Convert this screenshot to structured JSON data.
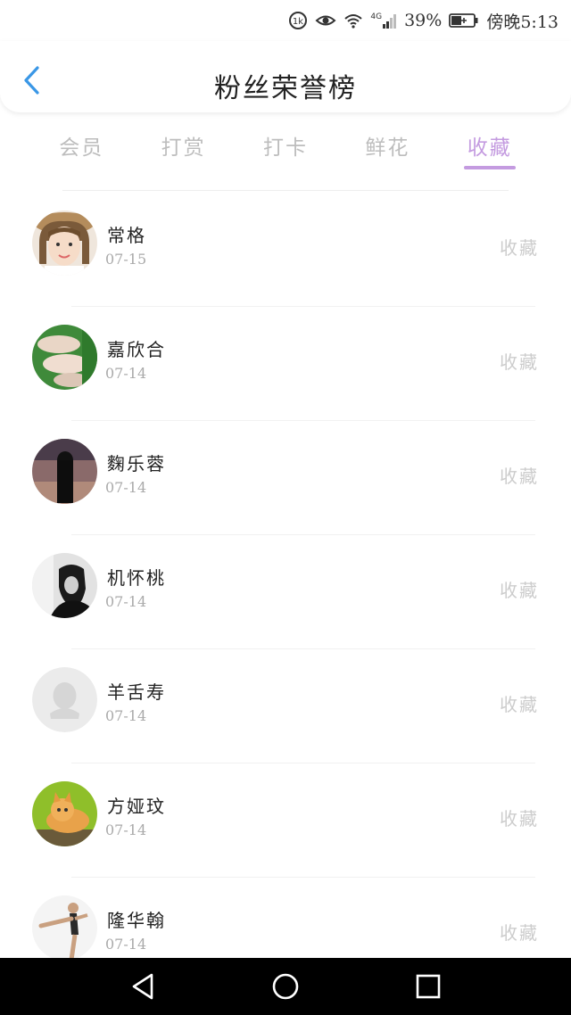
{
  "status_bar": {
    "badge_text": "1k",
    "network": "4G",
    "battery": "39%",
    "time": "傍晚5:13"
  },
  "header": {
    "title": "粉丝荣誉榜"
  },
  "tabs": [
    {
      "label": "会员"
    },
    {
      "label": "打赏"
    },
    {
      "label": "打卡"
    },
    {
      "label": "鲜花"
    },
    {
      "label": "收藏",
      "active": true
    }
  ],
  "list": [
    {
      "name": "常格",
      "date": "07-15",
      "action": "收藏",
      "avatar": "girl-photo"
    },
    {
      "name": "嘉欣合",
      "date": "07-14",
      "action": "收藏",
      "avatar": "fish-photo"
    },
    {
      "name": "麴乐蓉",
      "date": "07-14",
      "action": "收藏",
      "avatar": "long-hair-photo"
    },
    {
      "name": "机怀桃",
      "date": "07-14",
      "action": "收藏",
      "avatar": "bw-photo"
    },
    {
      "name": "羊舌寿",
      "date": "07-14",
      "action": "收藏",
      "avatar": "default-avatar"
    },
    {
      "name": "方娅玟",
      "date": "07-14",
      "action": "收藏",
      "avatar": "kitten-photo"
    },
    {
      "name": "隆华翰",
      "date": "07-14",
      "action": "收藏",
      "avatar": "kick-photo"
    }
  ],
  "colors": {
    "accent": "#c49be0",
    "inactive_tab": "#bdbdbd",
    "back_arrow": "#3a97e6",
    "nav_bar": "#000000"
  }
}
